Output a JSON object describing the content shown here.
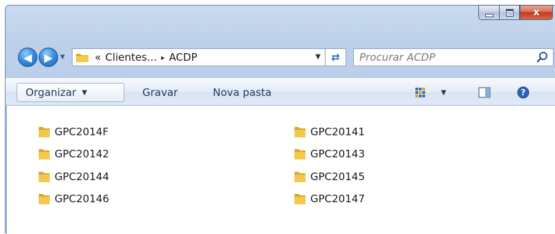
{
  "window": {
    "controls": {
      "minimize_icon": "minimize-icon",
      "maximize_icon": "maximize-icon",
      "close_glyph": "x"
    }
  },
  "navigation": {
    "back_icon": "back-arrow-icon",
    "forward_icon": "forward-arrow-icon",
    "address": {
      "overflow": "«",
      "crumbs": [
        "Clientes...",
        "ACDP"
      ],
      "separator": "▸"
    },
    "search_placeholder": "Procurar ACDP"
  },
  "toolbar": {
    "organizar": "Organizar",
    "organizar_caret": "▼",
    "gravar": "Gravar",
    "nova_pasta": "Nova pasta",
    "views_caret": "▼"
  },
  "files": [
    {
      "name": "GPC2014F"
    },
    {
      "name": "GPC20141"
    },
    {
      "name": "GPC20142"
    },
    {
      "name": "GPC20143"
    },
    {
      "name": "GPC20144"
    },
    {
      "name": "GPC20145"
    },
    {
      "name": "GPC20146"
    },
    {
      "name": "GPC20147"
    }
  ],
  "colors": {
    "folder_body": "#f2c94c",
    "folder_shade": "#d9a62a",
    "accent": "#1e395b"
  }
}
